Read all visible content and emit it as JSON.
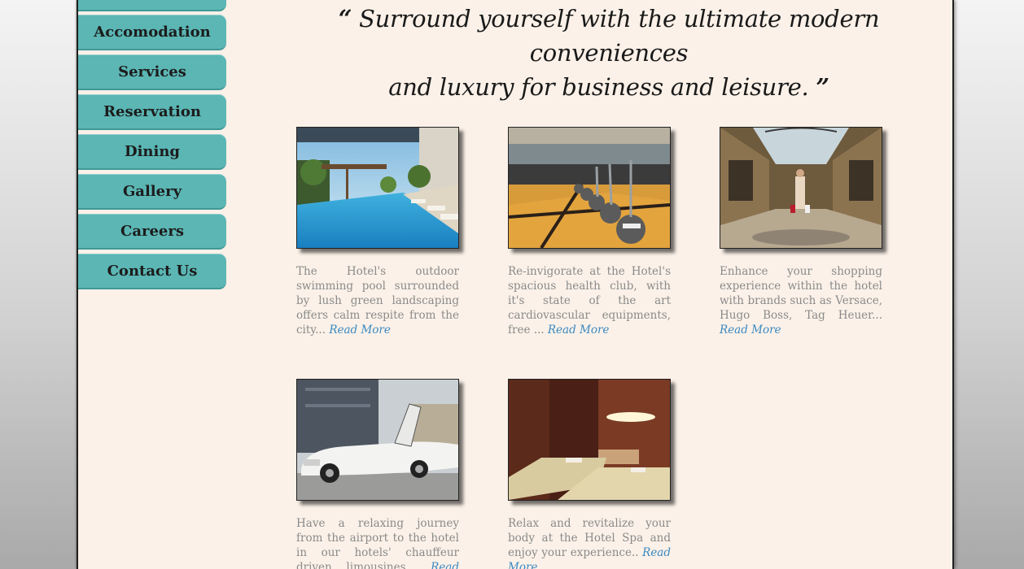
{
  "nav": {
    "items": [
      {
        "label": ""
      },
      {
        "label": "Accomodation"
      },
      {
        "label": "Services"
      },
      {
        "label": "Reservation"
      },
      {
        "label": "Dining"
      },
      {
        "label": "Gallery"
      },
      {
        "label": "Careers"
      },
      {
        "label": "Contact Us"
      }
    ]
  },
  "quote": {
    "open": "“",
    "line1": "Surround yourself with the ultimate modern conveniences",
    "line2": "and luxury for business and leisure.",
    "close": "”"
  },
  "cards": [
    {
      "image": "swimming-pool-photo",
      "text": "The Hotel's outdoor swimming pool surrounded by lush green landscaping offers calm respite from the city...",
      "link": "Read More"
    },
    {
      "image": "health-club-photo",
      "text": "Re-invigorate at the Hotel's spacious health club, with it's state of the art cardiovascular equipments, free ...",
      "link": "Read More"
    },
    {
      "image": "shopping-arcade-photo",
      "text": "Enhance your shopping experience within the hotel with brands such as Versace, Hugo Boss, Tag Heuer...",
      "link": "Read More"
    },
    {
      "image": "limousine-photo",
      "text": "Have a relaxing journey from the airport to the hotel in our hotels' chauffeur driven limousines...",
      "link": "Read More"
    },
    {
      "image": "spa-photo",
      "text": "Relax and revitalize your body at the Hotel Spa and enjoy your experience..",
      "link": "Read More"
    }
  ],
  "colors": {
    "nav_button": "#5bb6b4",
    "page_background": "#fbf1e8",
    "link": "#3a88c0",
    "body_text": "#8a8a8a"
  }
}
